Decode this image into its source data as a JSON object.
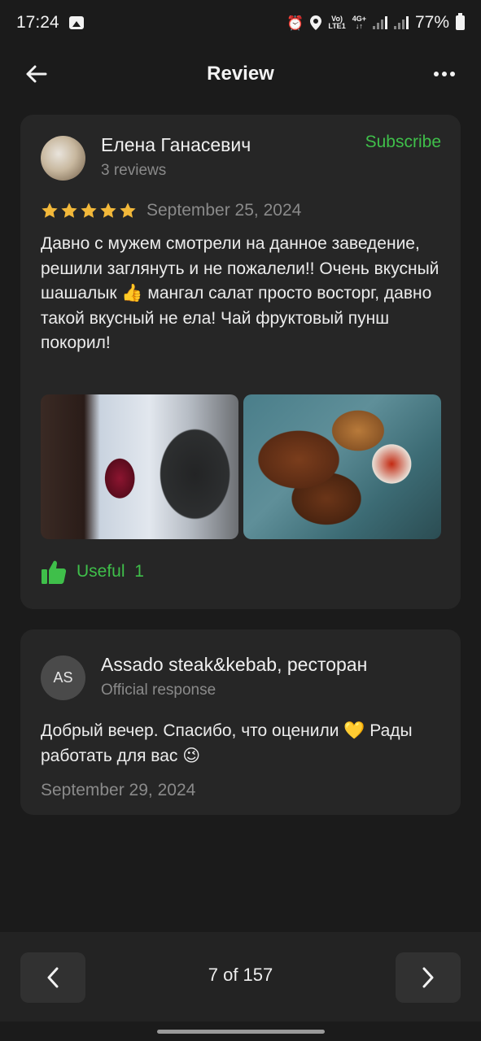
{
  "status_bar": {
    "time": "17:24",
    "network_top": "Vo)",
    "network_bottom": "LTE1",
    "network_type": "4G+",
    "battery": "77%"
  },
  "header": {
    "title": "Review"
  },
  "review": {
    "author": "Елена Ганасевич",
    "author_meta": "3 reviews",
    "subscribe_label": "Subscribe",
    "rating": 5,
    "date": "September 25, 2024",
    "text": "Давно с мужем смотрели на данное заведение, решили заглянуть и не пожалели!! Очень вкусный шашалык 👍 мангал салат просто восторг, давно такой вкусный не ела! Чай фруктовый пунш покорил!",
    "useful_label": "Useful",
    "useful_count": "1"
  },
  "response": {
    "avatar_initials": "AS",
    "business_name": "Assado steak&kebab, ресторан",
    "meta": "Official response",
    "text": "Добрый вечер. Спасибо, что оценили 💛 Рады работать для вас 😉",
    "date": "September 29, 2024"
  },
  "pagination": {
    "label": "7 of 157",
    "current": 7,
    "total": 157
  },
  "colors": {
    "accent_green": "#3fbf4a",
    "star_yellow": "#f2b83a",
    "background": "#1b1b1b",
    "card": "#262626"
  }
}
